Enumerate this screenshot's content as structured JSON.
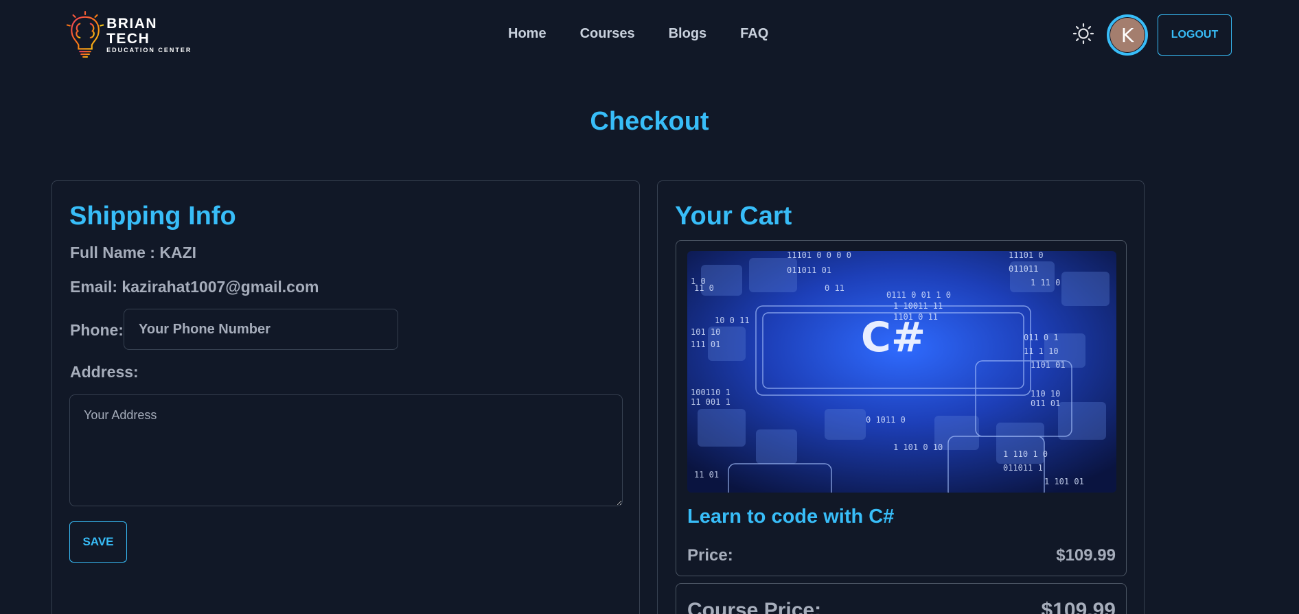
{
  "brand": {
    "title": "BRIAN TECH",
    "subtitle": "EDUCATION CENTER",
    "logo_icon": "brain-lightbulb-icon"
  },
  "nav": {
    "links": [
      "Home",
      "Courses",
      "Blogs",
      "FAQ"
    ],
    "theme_icon": "sun-icon",
    "avatar_initial": "K",
    "logout_label": "LOGOUT"
  },
  "page": {
    "title": "Checkout"
  },
  "shipping": {
    "title": "Shipping Info",
    "full_name": "Full Name : KAZI",
    "email": "Email: kazirahat1007@gmail.com",
    "phone_label": "Phone:",
    "phone_placeholder": "Your Phone Number",
    "address_label": "Address:",
    "address_placeholder": "Your Address",
    "save_label": "SAVE"
  },
  "cart": {
    "title": "Your Cart",
    "items": [
      {
        "name": "Learn to code with C#",
        "image_text": "C#",
        "price_label": "Price:",
        "price": "$109.99"
      }
    ],
    "total_label": "Course Price:",
    "total_value": "$109.99"
  },
  "colors": {
    "background": "#111827",
    "accent": "#38bdf8",
    "text": "#a6adbb",
    "border": "#374151"
  }
}
